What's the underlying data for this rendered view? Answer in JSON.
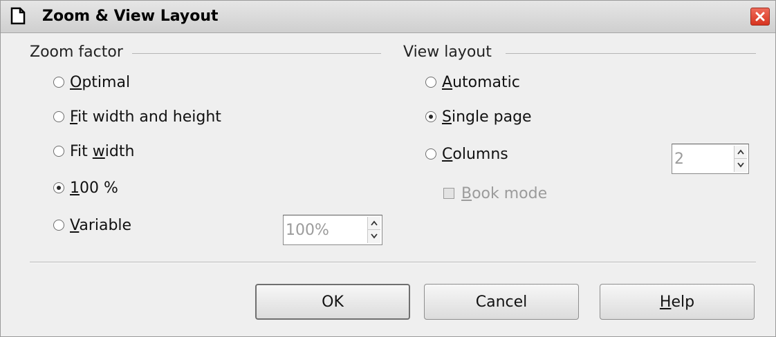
{
  "window": {
    "title": "Zoom & View Layout",
    "icon": "document-icon",
    "close_icon": "close-icon"
  },
  "zoom": {
    "title": "Zoom factor",
    "options": [
      {
        "pre": "",
        "key": "O",
        "post": "ptimal",
        "checked": false
      },
      {
        "pre": "",
        "key": "F",
        "post": "it width and height",
        "checked": false
      },
      {
        "pre": "Fit ",
        "key": "w",
        "post": "idth",
        "checked": false
      },
      {
        "pre": "",
        "key": "1",
        "post": "00 %",
        "checked": true
      },
      {
        "pre": "",
        "key": "V",
        "post": "ariable",
        "checked": false
      }
    ],
    "variable_value": "100%"
  },
  "view": {
    "title": "View layout",
    "options": [
      {
        "pre": "",
        "key": "A",
        "post": "utomatic",
        "checked": false
      },
      {
        "pre": "",
        "key": "S",
        "post": "ingle page",
        "checked": true
      },
      {
        "pre": "",
        "key": "C",
        "post": "olumns",
        "checked": false
      }
    ],
    "columns_value": "2",
    "book_mode": {
      "key": "B",
      "post": "ook mode",
      "checked": false,
      "enabled": false
    }
  },
  "buttons": {
    "ok": "OK",
    "cancel": "Cancel",
    "help_key": "H",
    "help_post": "elp"
  },
  "colors": {
    "close_button": "#d7341f",
    "dialog_bg": "#efefef",
    "disabled_text": "#9b9b9b"
  }
}
